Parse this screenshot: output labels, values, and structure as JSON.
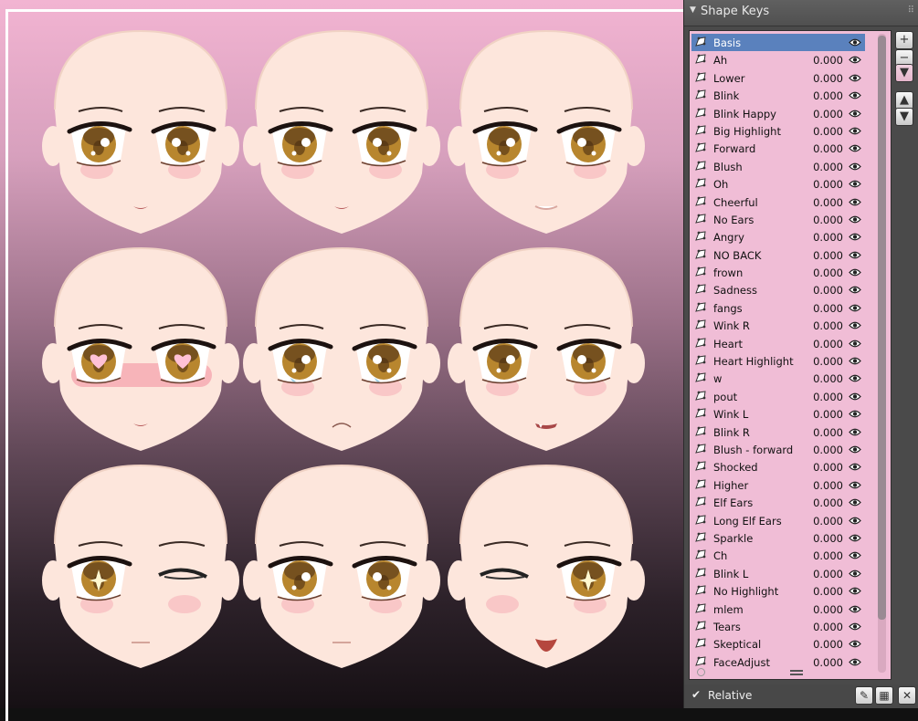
{
  "panel": {
    "title": "Shape Keys",
    "footer": {
      "relative_label": "Relative",
      "relative_checked": true
    }
  },
  "viewport": {
    "faces": [
      {
        "name": "neutral",
        "eyes": "open",
        "mouth": "small",
        "blush": "light"
      },
      {
        "name": "neutral-2",
        "eyes": "open",
        "mouth": "small",
        "blush": "light"
      },
      {
        "name": "smile",
        "eyes": "open",
        "mouth": "smile",
        "blush": "light"
      },
      {
        "name": "heart-eyes",
        "eyes": "heart",
        "mouth": "small",
        "blush": "strong"
      },
      {
        "name": "sad",
        "eyes": "teary",
        "mouth": "frown",
        "blush": "light"
      },
      {
        "name": "worried",
        "eyes": "open",
        "mouth": "fang",
        "blush": "light"
      },
      {
        "name": "wink-sparkle",
        "eyes": "wink-r",
        "mouth": "line",
        "blush": "light"
      },
      {
        "name": "neutral-3",
        "eyes": "open",
        "mouth": "line",
        "blush": "light"
      },
      {
        "name": "wink-smile",
        "eyes": "wink-l",
        "mouth": "open",
        "blush": "light"
      }
    ]
  },
  "shape_keys": [
    {
      "name": "Basis",
      "value": "",
      "selected": true
    },
    {
      "name": "Ah",
      "value": "0.000"
    },
    {
      "name": "Lower",
      "value": "0.000"
    },
    {
      "name": "Blink",
      "value": "0.000"
    },
    {
      "name": "Blink Happy",
      "value": "0.000"
    },
    {
      "name": "Big Highlight",
      "value": "0.000"
    },
    {
      "name": "Forward",
      "value": "0.000"
    },
    {
      "name": "Blush",
      "value": "0.000"
    },
    {
      "name": "Oh",
      "value": "0.000"
    },
    {
      "name": "Cheerful",
      "value": "0.000"
    },
    {
      "name": "No Ears",
      "value": "0.000"
    },
    {
      "name": "Angry",
      "value": "0.000"
    },
    {
      "name": "NO BACK",
      "value": "0.000"
    },
    {
      "name": "frown",
      "value": "0.000"
    },
    {
      "name": "Sadness",
      "value": "0.000"
    },
    {
      "name": "fangs",
      "value": "0.000"
    },
    {
      "name": "Wink R",
      "value": "0.000"
    },
    {
      "name": "Heart",
      "value": "0.000"
    },
    {
      "name": "Heart Highlight",
      "value": "0.000"
    },
    {
      "name": "w",
      "value": "0.000"
    },
    {
      "name": "pout",
      "value": "0.000"
    },
    {
      "name": "Wink L",
      "value": "0.000"
    },
    {
      "name": "Blink R",
      "value": "0.000"
    },
    {
      "name": "Blush - forward",
      "value": "0.000"
    },
    {
      "name": "Shocked",
      "value": "0.000"
    },
    {
      "name": "Higher",
      "value": "0.000"
    },
    {
      "name": "Elf Ears",
      "value": "0.000"
    },
    {
      "name": "Long Elf Ears",
      "value": "0.000"
    },
    {
      "name": "Sparkle",
      "value": "0.000"
    },
    {
      "name": "Ch",
      "value": "0.000"
    },
    {
      "name": "Blink L",
      "value": "0.000"
    },
    {
      "name": "No Highlight",
      "value": "0.000"
    },
    {
      "name": "mlem",
      "value": "0.000"
    },
    {
      "name": "Tears",
      "value": "0.000"
    },
    {
      "name": "Skeptical",
      "value": "0.000"
    },
    {
      "name": "FaceAdjust",
      "value": "0.000"
    }
  ],
  "side_buttons": [
    {
      "name": "add-shape-key-button",
      "glyph": "+"
    },
    {
      "name": "remove-shape-key-button",
      "glyph": "−"
    },
    {
      "name": "specials-menu-button",
      "glyph": "▼"
    },
    {
      "name": "move-up-button",
      "glyph": "▲"
    },
    {
      "name": "move-down-button",
      "glyph": "▼"
    }
  ],
  "colors": {
    "list_bg": "#f0bdd6",
    "selected_row": "#5a81bd",
    "skin": "#fde6dc",
    "iris": "#b8862e"
  }
}
